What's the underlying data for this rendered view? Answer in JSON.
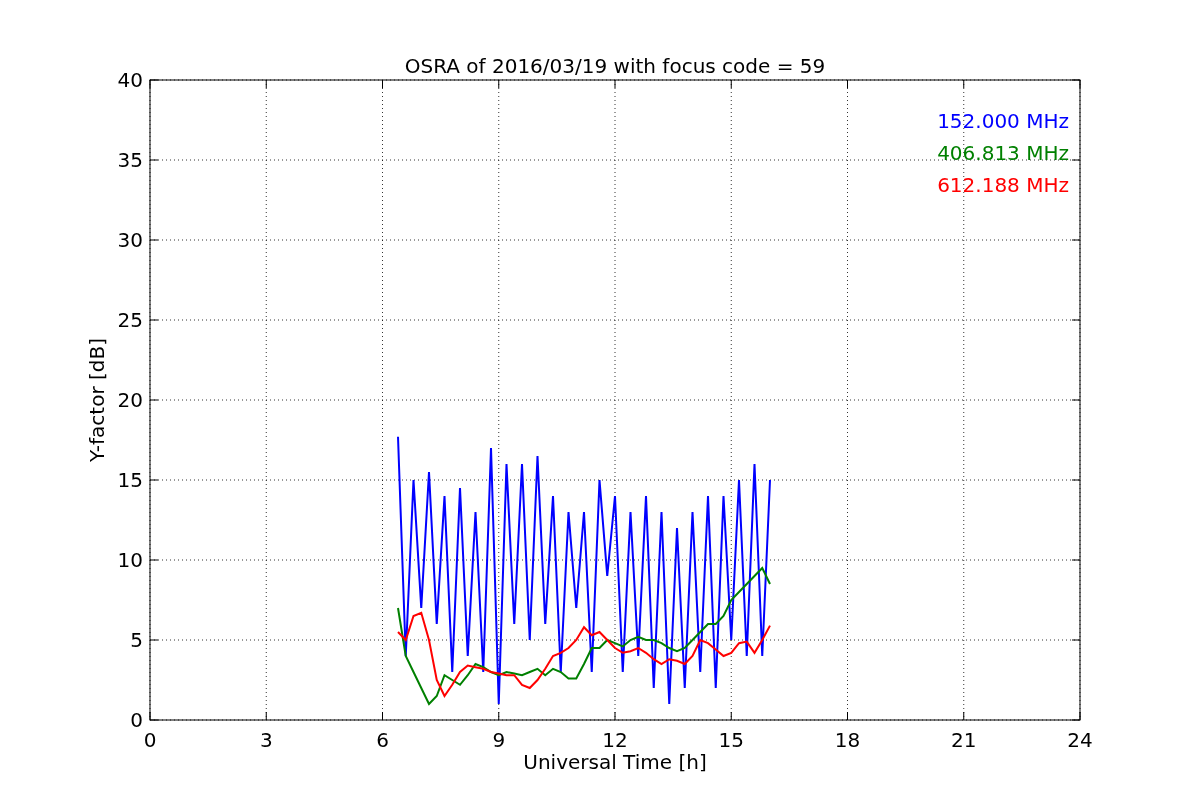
{
  "figure": {
    "chart_data": {
      "type": "line",
      "title": "OSRA of 2016/03/19 with focus code = 59",
      "xlabel": "Universal Time [h]",
      "ylabel": "Y-factor [dB]",
      "xlim": [
        0,
        24
      ],
      "ylim": [
        0,
        40
      ],
      "xticks": [
        0,
        3,
        6,
        9,
        12,
        15,
        18,
        21,
        24
      ],
      "yticks": [
        0,
        5,
        10,
        15,
        20,
        25,
        30,
        35,
        40
      ],
      "grid": true,
      "x": [
        6.4,
        6.6,
        6.8,
        7.0,
        7.2,
        7.4,
        7.6,
        7.8,
        8.0,
        8.2,
        8.4,
        8.6,
        8.8,
        9.0,
        9.2,
        9.4,
        9.6,
        9.8,
        10.0,
        10.2,
        10.4,
        10.6,
        10.8,
        11.0,
        11.2,
        11.4,
        11.6,
        11.8,
        12.0,
        12.2,
        12.4,
        12.6,
        12.8,
        13.0,
        13.2,
        13.4,
        13.6,
        13.8,
        14.0,
        14.2,
        14.4,
        14.6,
        14.8,
        15.0,
        15.2,
        15.4,
        15.6,
        15.8,
        16.0
      ],
      "series": [
        {
          "name": "152.000 MHz",
          "color": "#0000ff",
          "values": [
            17.7,
            4,
            15,
            7,
            15.5,
            6,
            14,
            3,
            14.5,
            4,
            13,
            3,
            17,
            1,
            16,
            6,
            16,
            5,
            16.5,
            6,
            14,
            3,
            13,
            7,
            13,
            3,
            15,
            9,
            14,
            3,
            13,
            4,
            14,
            2,
            13,
            1,
            12,
            2,
            13,
            3,
            14,
            2,
            14,
            5,
            15,
            4,
            16,
            4,
            15
          ]
        },
        {
          "name": "406.813 MHz",
          "color": "#008000",
          "values": [
            7,
            4,
            3,
            2,
            1,
            1.5,
            2.8,
            2.5,
            2.2,
            2.8,
            3.5,
            3.3,
            3,
            2.8,
            3,
            2.9,
            2.8,
            3,
            3.2,
            2.8,
            3.2,
            3,
            2.6,
            2.6,
            3.5,
            4.5,
            4.5,
            5,
            4.8,
            4.6,
            5,
            5.2,
            5,
            5,
            4.8,
            4.5,
            4.3,
            4.5,
            5,
            5.5,
            6,
            6,
            6.5,
            7.5,
            8,
            8.5,
            9,
            9.5,
            8.5
          ]
        },
        {
          "name": "612.188 MHz",
          "color": "#ff0000",
          "values": [
            5.5,
            5,
            6.5,
            6.7,
            5,
            2.5,
            1.5,
            2.2,
            3,
            3.4,
            3.3,
            3.2,
            3,
            2.9,
            2.8,
            2.8,
            2.2,
            2,
            2.5,
            3.2,
            4,
            4.2,
            4.5,
            5,
            5.8,
            5.3,
            5.5,
            5,
            4.5,
            4.2,
            4.3,
            4.5,
            4.2,
            3.8,
            3.5,
            3.8,
            3.7,
            3.5,
            4,
            5,
            4.8,
            4.4,
            4,
            4.2,
            4.8,
            4.9,
            4.2,
            5,
            5.9
          ]
        }
      ]
    }
  }
}
